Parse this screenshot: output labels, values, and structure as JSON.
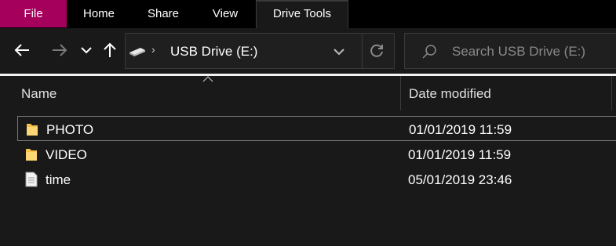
{
  "ribbon": {
    "tabs": [
      {
        "label": "File"
      },
      {
        "label": "Home"
      },
      {
        "label": "Share"
      },
      {
        "label": "View"
      },
      {
        "label": "Drive Tools"
      }
    ]
  },
  "nav": {
    "back_icon": "arrow-left-icon",
    "forward_icon": "arrow-right-icon",
    "recent_icon": "chevron-down-icon",
    "up_icon": "arrow-up-icon"
  },
  "address": {
    "path": "USB Drive (E:)",
    "drive_icon": "usb-drive-icon"
  },
  "search": {
    "placeholder": "Search USB Drive (E:)"
  },
  "columns": {
    "name": "Name",
    "date_modified": "Date modified"
  },
  "files": [
    {
      "name": "PHOTO",
      "date": "01/01/2019 11:59",
      "type": "folder",
      "selected": true
    },
    {
      "name": "VIDEO",
      "date": "01/01/2019 11:59",
      "type": "folder",
      "selected": false
    },
    {
      "name": "time",
      "date": "05/01/2019 23:46",
      "type": "text-file",
      "selected": false
    }
  ],
  "colors": {
    "file_tab": "#a5005c",
    "background": "#191919",
    "folder": "#f7c04a"
  }
}
